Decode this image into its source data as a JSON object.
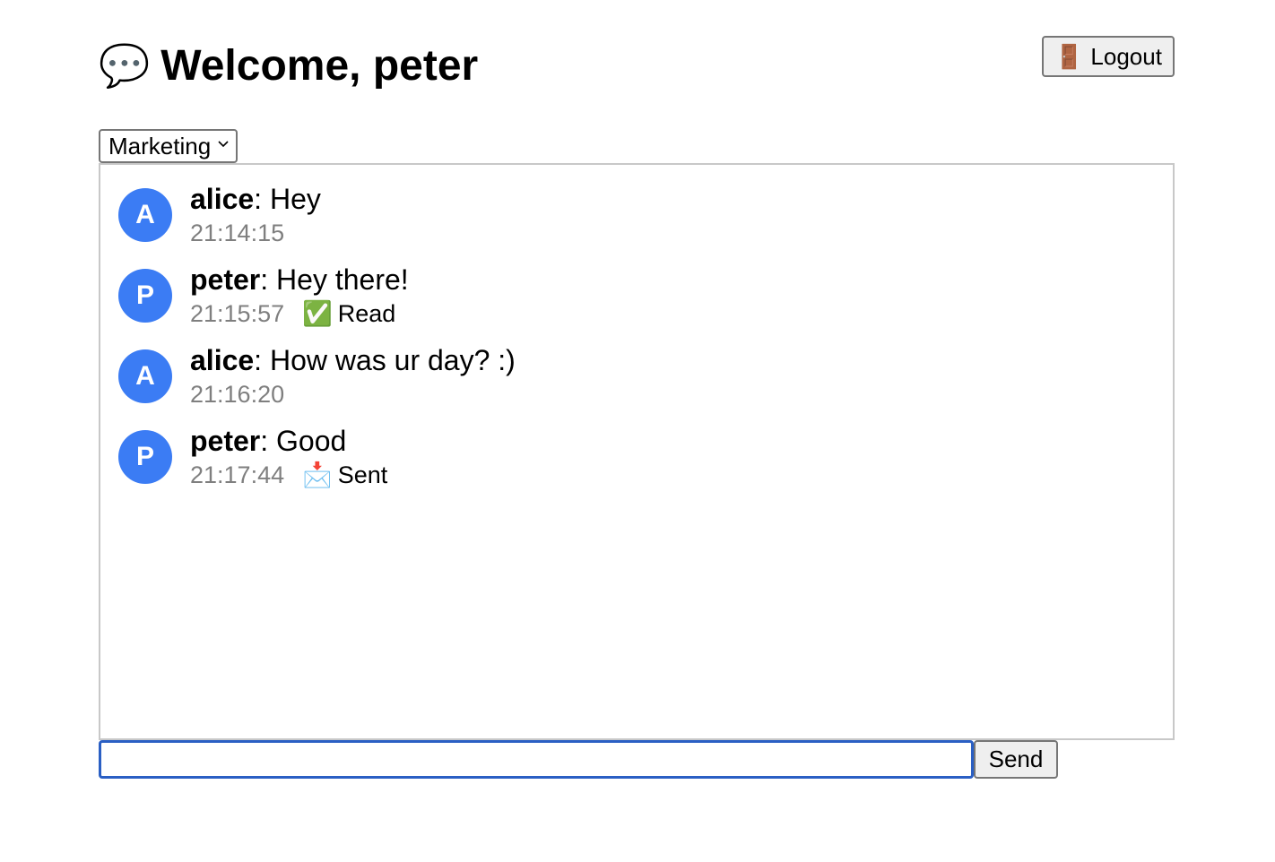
{
  "header": {
    "icon": "speech-balloon-icon",
    "icon_glyph": "💬",
    "title": "Welcome, peter",
    "logout_icon": "door-icon",
    "logout_icon_glyph": "🚪",
    "logout_label": "Logout"
  },
  "room_select": {
    "selected": "Marketing"
  },
  "messages": [
    {
      "avatar": "A",
      "user": "alice",
      "text": "Hey",
      "time": "21:14:15",
      "status": "",
      "status_icon": ""
    },
    {
      "avatar": "P",
      "user": "peter",
      "text": "Hey there!",
      "time": "21:15:57",
      "status": "Read",
      "status_icon": "✅"
    },
    {
      "avatar": "A",
      "user": "alice",
      "text": "How was ur day? :)",
      "time": "21:16:20",
      "status": "",
      "status_icon": ""
    },
    {
      "avatar": "P",
      "user": "peter",
      "text": "Good",
      "time": "21:17:44",
      "status": "Sent",
      "status_icon": "📩"
    }
  ],
  "composer": {
    "value": "",
    "placeholder": "",
    "send_label": "Send"
  },
  "colors": {
    "avatar_bg": "#3b7cf4",
    "input_focus_border": "#2a5fc4",
    "timestamp": "#7f7f7f"
  }
}
